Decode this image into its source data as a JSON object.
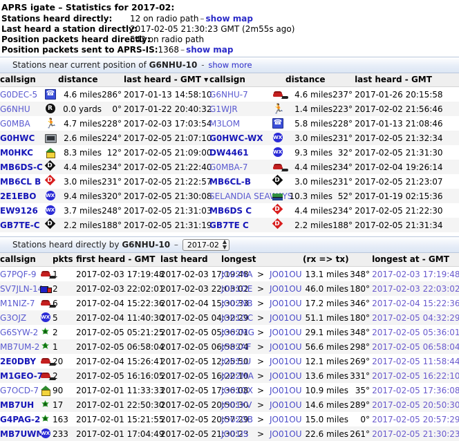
{
  "summary": {
    "title": "APRS igate – Statistics for 2017-02:",
    "rows": [
      {
        "label": "Stations heard directly:",
        "value": "12 on radio path",
        "dash": "–",
        "link": "show map"
      },
      {
        "label": "Last heard a station directly:",
        "value": "2017-02-05 21:30:23 GMT (2m55s ago)",
        "dash": "",
        "link": ""
      },
      {
        "label": "Position packets heard directly:",
        "value": "542 on radio path",
        "dash": "",
        "link": ""
      },
      {
        "label": "Position packets sent to APRS-IS:",
        "value": "1368",
        "dash": "–",
        "link": "show map"
      }
    ]
  },
  "near_section": {
    "text_before": "Stations near current position of",
    "callsign": "G6NHU-10",
    "dash": "-",
    "link": "show more"
  },
  "near_table": {
    "headers": [
      "callsign",
      "distance",
      "last heard - GMT",
      "callsign",
      "distance",
      "last heard - GMT"
    ],
    "sort_marker": "▾",
    "rows": [
      {
        "left": {
          "callsign": "G0DEC-5",
          "bold": false,
          "icon": "phone-icon",
          "dist": "4.6 miles",
          "brg": "286°",
          "heard": "2017-01-13 14:58:10"
        },
        "right": {
          "callsign": "G6NHU-7",
          "bold": false,
          "icon": "car-icon",
          "dist": "4.6 miles",
          "brg": "237°",
          "heard": "2017-01-26 20:15:58"
        }
      },
      {
        "left": {
          "callsign": "G6NHU",
          "bold": false,
          "icon": "rnode-icon",
          "dist": "0.0 yards",
          "brg": "0°",
          "heard": "2017-01-22 20:40:32"
        },
        "right": {
          "callsign": "G1WJR",
          "bold": false,
          "icon": "runner-icon",
          "dist": "1.4 miles",
          "brg": "223°",
          "heard": "2017-02-02 21:56:46"
        }
      },
      {
        "left": {
          "callsign": "G0MBA",
          "bold": false,
          "icon": "runner-icon",
          "dist": "4.7 miles",
          "brg": "228°",
          "heard": "2017-02-03 17:03:54"
        },
        "right": {
          "callsign": "M3LOM",
          "bold": false,
          "icon": "phone-icon",
          "dist": "5.8 miles",
          "brg": "228°",
          "heard": "2017-01-13 21:08:46"
        }
      },
      {
        "left": {
          "callsign": "G0HWC",
          "bold": true,
          "icon": "tv-icon",
          "dist": "2.6 miles",
          "brg": "224°",
          "heard": "2017-02-05 21:07:10"
        },
        "right": {
          "callsign": "G0HWC-WX",
          "bold": true,
          "icon": "wx-icon",
          "dist": "3.0 miles",
          "brg": "231°",
          "heard": "2017-02-05 21:32:34"
        }
      },
      {
        "left": {
          "callsign": "M0HKC",
          "bold": true,
          "icon": "house-icon",
          "dist": "8.3 miles",
          "brg": "12°",
          "heard": "2017-02-05 21:09:00"
        },
        "right": {
          "callsign": "DW4461",
          "bold": true,
          "icon": "wx-icon",
          "dist": "9.3 miles",
          "brg": "32°",
          "heard": "2017-02-05 21:31:30"
        }
      },
      {
        "left": {
          "callsign": "MB6DS-C",
          "bold": true,
          "icon": "digi-black-icon",
          "dist": "4.4 miles",
          "brg": "234°",
          "heard": "2017-02-05 21:22:40"
        },
        "right": {
          "callsign": "G0MBA-7",
          "bold": false,
          "icon": "car-icon",
          "dist": "4.4 miles",
          "brg": "234°",
          "heard": "2017-02-04 19:26:14"
        }
      },
      {
        "left": {
          "callsign": "MB6CL B",
          "bold": true,
          "icon": "digi-red-icon",
          "dist": "3.0 miles",
          "brg": "231°",
          "heard": "2017-02-05 21:22:57"
        },
        "right": {
          "callsign": "MB6CL-B",
          "bold": true,
          "icon": "digi-black-icon",
          "dist": "3.0 miles",
          "brg": "231°",
          "heard": "2017-02-05 21:23:07"
        }
      },
      {
        "left": {
          "callsign": "2E1EBO",
          "bold": true,
          "icon": "wx-icon",
          "dist": "9.4 miles",
          "brg": "320°",
          "heard": "2017-02-05 21:30:08"
        },
        "right": {
          "callsign": "SELANDIA SEAWAYS",
          "bold": false,
          "icon": "ship-icon",
          "dist": "10.3 miles",
          "brg": "52°",
          "heard": "2017-01-19 02:15:36"
        }
      },
      {
        "left": {
          "callsign": "EW9126",
          "bold": true,
          "icon": "wx-icon",
          "dist": "3.7 miles",
          "brg": "248°",
          "heard": "2017-02-05 21:31:03"
        },
        "right": {
          "callsign": "MB6DS C",
          "bold": true,
          "icon": "digi-red-icon",
          "dist": "4.4 miles",
          "brg": "234°",
          "heard": "2017-02-05 21:22:30"
        }
      },
      {
        "left": {
          "callsign": "GB7TE-C",
          "bold": true,
          "icon": "digi-black-icon",
          "dist": "2.2 miles",
          "brg": "188°",
          "heard": "2017-02-05 21:31:19"
        },
        "right": {
          "callsign": "GB7TE C",
          "bold": true,
          "icon": "digi-red-icon",
          "dist": "2.2 miles",
          "brg": "188°",
          "heard": "2017-02-05 21:31:34"
        }
      }
    ]
  },
  "heard_section": {
    "text_before": "Stations heard directly by",
    "callsign": "G6NHU-10",
    "dash": "–",
    "selected_month": "2017-02"
  },
  "heard_table": {
    "headers": [
      "callsign",
      "pkts",
      "first heard - GMT",
      "last heard",
      "longest",
      "(rx => tx)",
      "longest at - GMT"
    ],
    "rows": [
      {
        "callsign": "G7PQF-9",
        "bold": false,
        "icon": "car-icon",
        "pkts": "1",
        "first": "2017-02-03 17:19:48",
        "last": "2017-02-03 17:19:48",
        "from": "JO02NA",
        "arrow": ">",
        "to": "JO01OU",
        "dist": "13.1 miles",
        "brg": "348°",
        "at": "2017-02-03 17:19:48"
      },
      {
        "callsign": "SV7JLN-14",
        "bold": false,
        "icon": "truck-icon",
        "pkts": "2",
        "first": "2017-02-03 22:02:01",
        "last": "2017-02-03 22:03:02",
        "from": "JO01OE",
        "arrow": ">",
        "to": "JO01OU",
        "dist": "46.0 miles",
        "brg": "180°",
        "at": "2017-02-03 22:03:02"
      },
      {
        "callsign": "M1NIZ-7",
        "bold": false,
        "icon": "car-icon",
        "pkts": "6",
        "first": "2017-02-04 15:22:36",
        "last": "2017-02-04 15:30:33",
        "from": "JO02NB",
        "arrow": ">",
        "to": "JO01OU",
        "dist": "17.2 miles",
        "brg": "346°",
        "at": "2017-02-04 15:22:36"
      },
      {
        "callsign": "G3OJZ",
        "bold": false,
        "icon": "wx-icon",
        "pkts": "5",
        "first": "2017-02-04 11:40:30",
        "last": "2017-02-05 04:32:29",
        "from": "JO01OC",
        "arrow": ">",
        "to": "JO01OU",
        "dist": "51.1 miles",
        "brg": "180°",
        "at": "2017-02-05 04:32:29"
      },
      {
        "callsign": "G6SYW-2",
        "bold": false,
        "icon": "digi-star-icon",
        "pkts": "2",
        "first": "2017-02-05 05:21:25",
        "last": "2017-02-05 05:36:01",
        "from": "JO02MG",
        "arrow": ">",
        "to": "JO01OU",
        "dist": "29.1 miles",
        "brg": "348°",
        "at": "2017-02-05 05:36:01"
      },
      {
        "callsign": "MB7UM-2",
        "bold": false,
        "icon": "star-s-icon",
        "pkts": "1",
        "first": "2017-02-05 06:58:04",
        "last": "2017-02-05 06:58:04",
        "from": "JO02AF",
        "arrow": ">",
        "to": "JO01OU",
        "dist": "56.6 miles",
        "brg": "298°",
        "at": "2017-02-05 06:58:04"
      },
      {
        "callsign": "2E0DBY",
        "bold": true,
        "icon": "car-icon",
        "pkts": "20",
        "first": "2017-02-04 15:26:41",
        "last": "2017-02-05 12:25:50",
        "from": "JO01LU",
        "arrow": ">",
        "to": "JO01OU",
        "dist": "12.1 miles",
        "brg": "269°",
        "at": "2017-02-05 11:58:44"
      },
      {
        "callsign": "M1GEO-7",
        "bold": true,
        "icon": "car-icon",
        "pkts": "2",
        "first": "2017-02-05 16:16:05",
        "last": "2017-02-05 16:22:10",
        "from": "JO02MA",
        "arrow": ">",
        "to": "JO01OU",
        "dist": "13.6 miles",
        "brg": "331°",
        "at": "2017-02-05 16:22:10"
      },
      {
        "callsign": "G7OCD-7",
        "bold": false,
        "icon": "house-icon",
        "pkts": "90",
        "first": "2017-02-01 11:33:33",
        "last": "2017-02-05 17:36:08",
        "from": "JO01QX",
        "arrow": ">",
        "to": "JO01OU",
        "dist": "10.9 miles",
        "brg": "35°",
        "at": "2017-02-05 17:36:08"
      },
      {
        "callsign": "MB7UH",
        "bold": true,
        "icon": "digi-star-icon",
        "pkts": "17",
        "first": "2017-02-01 22:50:30",
        "last": "2017-02-05 20:50:30",
        "from": "JO01KV",
        "arrow": ">",
        "to": "JO01OU",
        "dist": "14.6 miles",
        "brg": "289°",
        "at": "2017-02-05 20:50:30"
      },
      {
        "callsign": "G4PAG-2",
        "bold": true,
        "icon": "digi-star-icon",
        "pkts": "163",
        "first": "2017-02-01 15:21:55",
        "last": "2017-02-05 20:57:29",
        "from": "JO02OB",
        "arrow": ">",
        "to": "JO01OU",
        "dist": "15.0 miles",
        "brg": "0°",
        "at": "2017-02-05 20:57:29"
      },
      {
        "callsign": "MB7UWM",
        "bold": true,
        "icon": "wx-icon",
        "pkts": "233",
        "first": "2017-02-01 17:04:49",
        "last": "2017-02-05 21:30:23",
        "from": "JO01IS",
        "arrow": ">",
        "to": "JO01OU",
        "dist": "22.6 miles",
        "brg": "261°",
        "at": "2017-02-05 21:30:23"
      }
    ]
  }
}
